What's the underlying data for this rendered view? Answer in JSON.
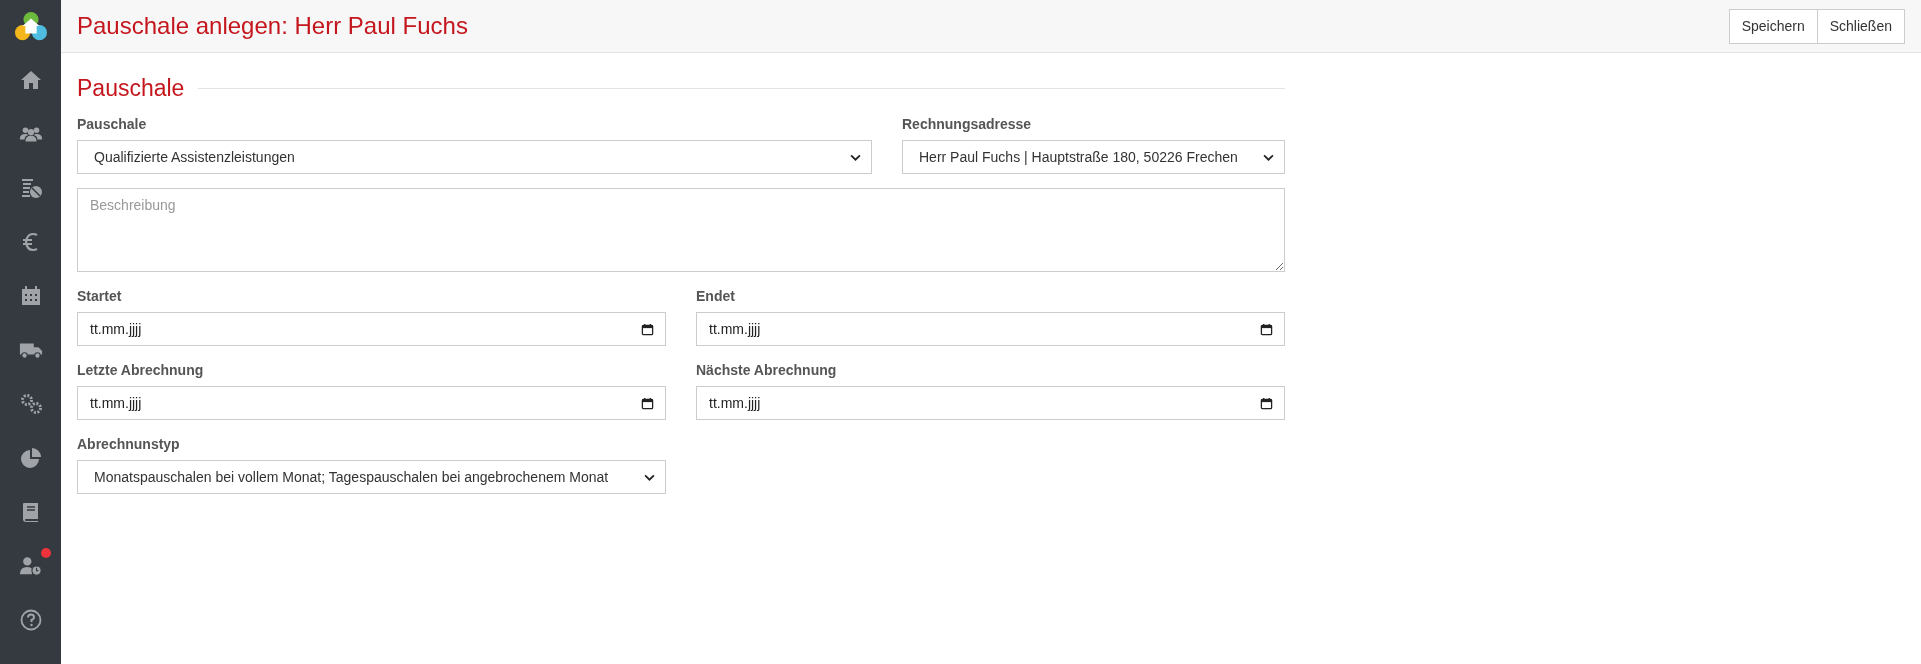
{
  "sidebar": {
    "notification_dot": true
  },
  "header": {
    "title": "Pauschale anlegen: Herr Paul Fuchs",
    "buttons": [
      "Speichern",
      "Schließen"
    ]
  },
  "section": {
    "title": "Pauschale"
  },
  "fields": {
    "pauschale": {
      "label": "Pauschale",
      "value": "Qualifizierte Assistenzleistungen"
    },
    "rechnungsadresse": {
      "label": "Rechnungsadresse",
      "value": "Herr Paul Fuchs | Hauptstraße 180, 50226 Frechen"
    },
    "beschreibung": {
      "placeholder": "Beschreibung"
    },
    "startet": {
      "label": "Startet",
      "placeholder": "tt.mm.jjjj"
    },
    "endet": {
      "label": "Endet",
      "placeholder": "tt.mm.jjjj"
    },
    "letzte_abrechnung": {
      "label": "Letzte Abrechnung",
      "placeholder": "tt.mm.jjjj"
    },
    "naechste_abrechnung": {
      "label": "Nächste Abrechnung",
      "placeholder": "tt.mm.jjjj"
    },
    "abrechnungstyp": {
      "label": "Abrechnunstyp",
      "value": "Monatspauschalen bei vollem Monat; Tagespauschalen bei angebrochenem Monat"
    }
  }
}
